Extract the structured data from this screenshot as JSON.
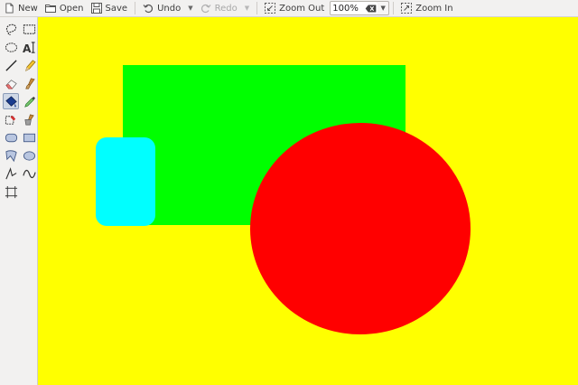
{
  "toolbar": {
    "new_label": "New",
    "open_label": "Open",
    "save_label": "Save",
    "undo_label": "Undo",
    "redo_label": "Redo",
    "zoom_out_label": "Zoom Out",
    "zoom_value": "100%",
    "zoom_in_label": "Zoom In"
  },
  "tools": [
    "lasso-select",
    "rectangle-select",
    "ellipse-select",
    "text",
    "line",
    "pencil",
    "eraser",
    "paintbrush",
    "paint-bucket",
    "color-picker",
    "clone-stamp",
    "recolor",
    "rounded-rectangle",
    "rectangle",
    "freeform-shape",
    "ellipse",
    "polygon",
    "curve",
    "crop"
  ],
  "canvas": {
    "background_color": "#ffff00",
    "shapes": [
      {
        "name": "green-rectangle",
        "color": "#00ff00"
      },
      {
        "name": "cyan-rounded-rectangle",
        "color": "#00ffff"
      },
      {
        "name": "red-ellipse",
        "color": "#ff0000"
      }
    ]
  }
}
